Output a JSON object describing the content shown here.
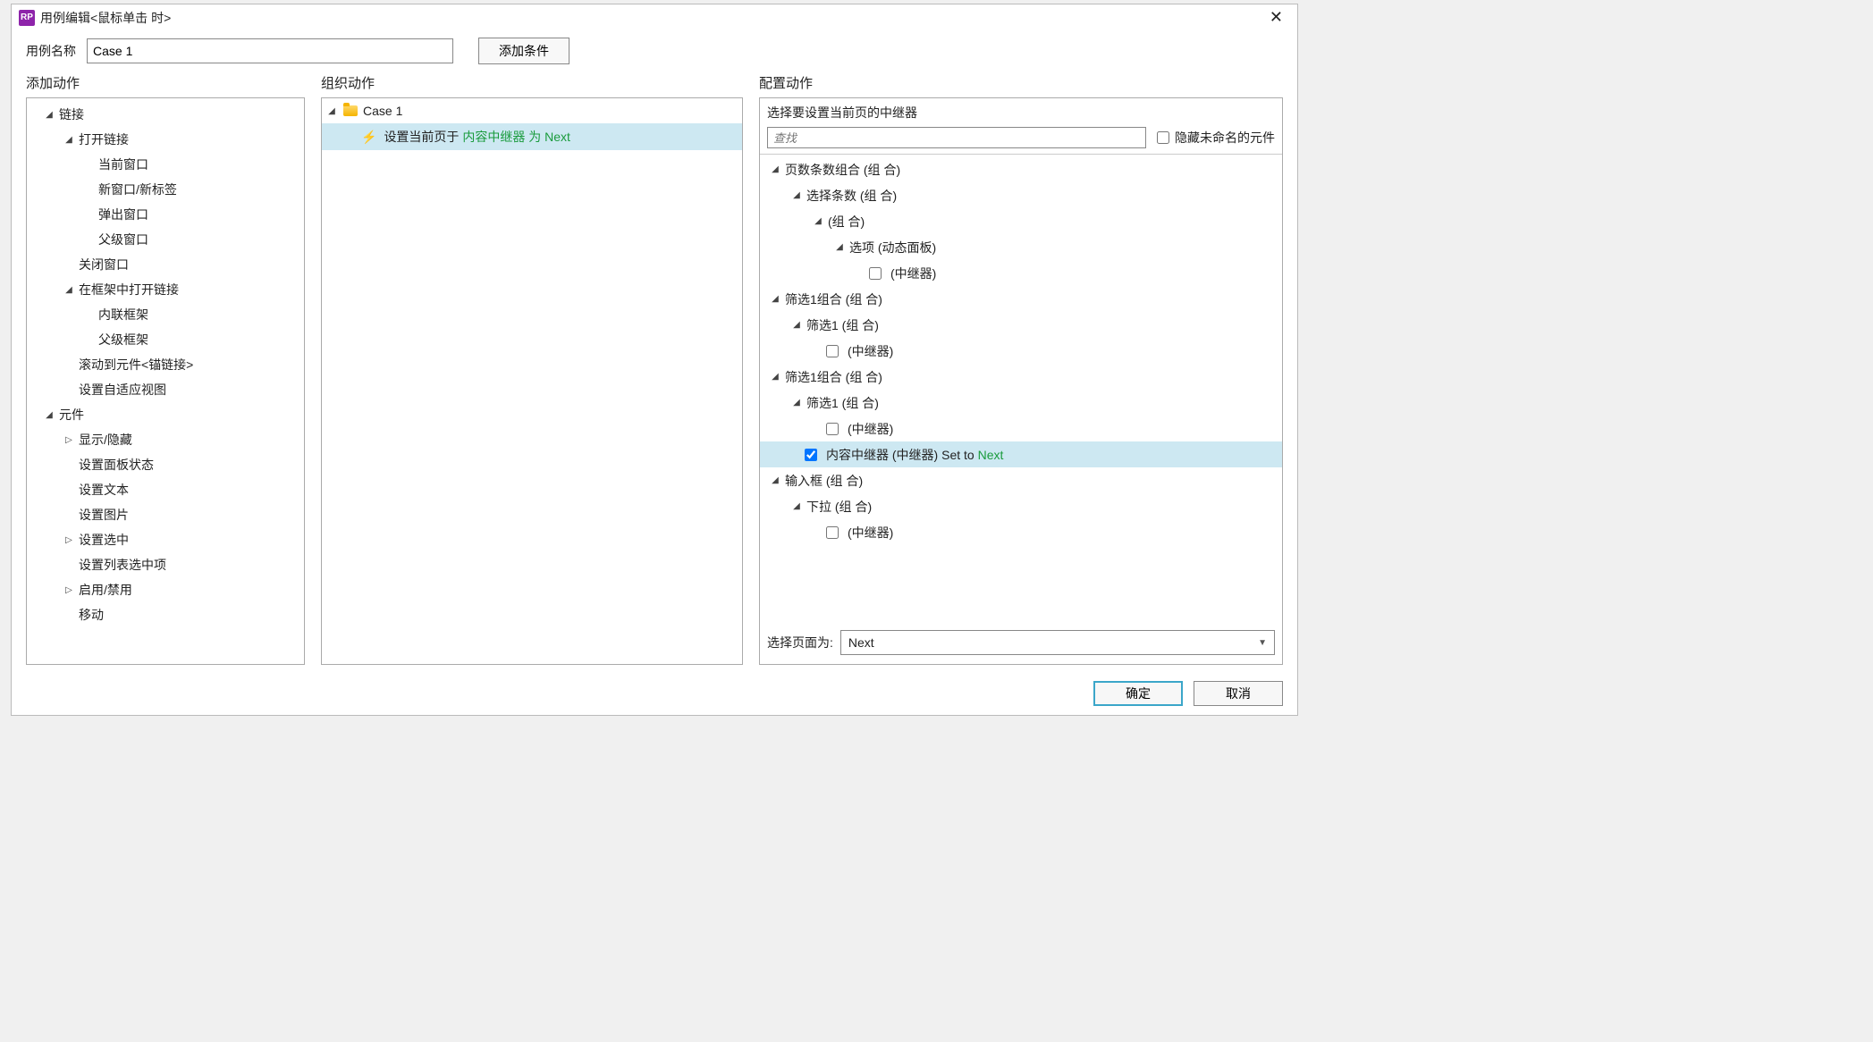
{
  "titlebar": {
    "app_badge": "RP",
    "title": "用例编辑<鼠标单击 时>"
  },
  "toprow": {
    "case_name_label": "用例名称",
    "case_name_value": "Case 1",
    "add_condition": "添加条件"
  },
  "columns": {
    "left_title": "添加动作",
    "mid_title": "组织动作",
    "right_title": "配置动作"
  },
  "action_tree": {
    "g_link": "链接",
    "g_open_link": "打开链接",
    "i_current_window": "当前窗口",
    "i_new_window": "新窗口/新标签",
    "i_popup_window": "弹出窗口",
    "i_parent_window": "父级窗口",
    "i_close_window": "关闭窗口",
    "g_open_in_frame": "在框架中打开链接",
    "i_inline_frame": "内联框架",
    "i_parent_frame": "父级框架",
    "i_scroll_to_anchor": "滚动到元件<锚链接>",
    "i_set_adaptive_view": "设置自适应视图",
    "g_widget": "元件",
    "i_show_hide": "显示/隐藏",
    "i_set_panel_state": "设置面板状态",
    "i_set_text": "设置文本",
    "i_set_image": "设置图片",
    "i_set_selected": "设置选中",
    "i_set_list_selected": "设置列表选中项",
    "i_enable_disable": "启用/禁用",
    "i_move": "移动"
  },
  "organized": {
    "case_name": "Case 1",
    "action_prefix": "设置当前页于",
    "action_target": "内容中继器",
    "action_mid": "为",
    "action_value": "Next"
  },
  "config": {
    "header": "选择要设置当前页的中继器",
    "search_placeholder": "查找",
    "hide_unnamed_label": "隐藏未命名的元件",
    "tree": {
      "n1": "页数条数组合 (组 合)",
      "n2": "选择条数 (组 合)",
      "n3": "(组 合)",
      "n4": "选项 (动态面板)",
      "n5": "(中继器)",
      "n6": "筛选1组合 (组 合)",
      "n7": "筛选1 (组 合)",
      "n8": "(中继器)",
      "n9": "筛选1组合 (组 合)",
      "n10": "筛选1 (组 合)",
      "n11": "(中继器)",
      "n12_pre": "内容中继器 (中继器) Set to ",
      "n12_val": "Next",
      "n13": "输入框 (组 合)",
      "n14": "下拉 (组 合)",
      "n15": "(中继器)"
    },
    "select_page_label": "选择页面为:",
    "select_page_value": "Next"
  },
  "footer": {
    "ok": "确定",
    "cancel": "取消"
  }
}
